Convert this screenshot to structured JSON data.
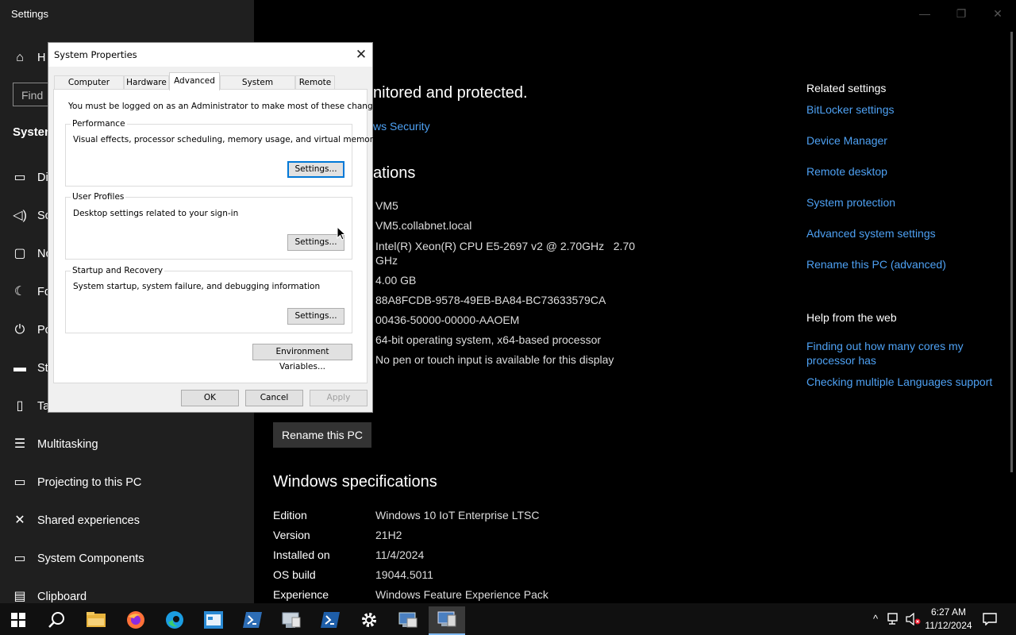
{
  "window": {
    "title": "Settings",
    "minimize": "—",
    "restore": "❐",
    "close": "✕"
  },
  "sidebar": {
    "home_label": "H",
    "find_placeholder": "Find",
    "system_label": "System",
    "items": [
      {
        "label": "Di",
        "icon": "display-icon",
        "glyph": "▭"
      },
      {
        "label": "Sc",
        "icon": "sound-icon",
        "glyph": "🔈"
      },
      {
        "label": "No",
        "icon": "notifications-icon",
        "glyph": "▢"
      },
      {
        "label": "Fo",
        "icon": "focus-assist-icon",
        "glyph": "☾"
      },
      {
        "label": "Po",
        "icon": "power-icon",
        "glyph": "⏻"
      },
      {
        "label": "St",
        "icon": "storage-icon",
        "glyph": "▬"
      },
      {
        "label": "Ta",
        "icon": "tablet-icon",
        "glyph": "▯"
      },
      {
        "label": "Multitasking",
        "icon": "multitasking-icon",
        "glyph": "☰"
      },
      {
        "label": "Projecting to this PC",
        "icon": "projecting-icon",
        "glyph": "▭"
      },
      {
        "label": "Shared experiences",
        "icon": "shared-experiences-icon",
        "glyph": "✕"
      },
      {
        "label": "System Components",
        "icon": "system-components-icon",
        "glyph": "▭"
      },
      {
        "label": "Clipboard",
        "icon": "clipboard-icon",
        "glyph": "▤"
      }
    ]
  },
  "main": {
    "protected_heading": "nitored and protected.",
    "security_link": "ws Security",
    "specs_heading": "ations",
    "device_values": [
      "VM5",
      "VM5.collabnet.local",
      "Intel(R) Xeon(R) CPU E5-2697 v2 @ 2.70GHz   2.70",
      "GHz",
      "4.00 GB",
      "88A8FCDB-9578-49EB-BA84-BC73633579CA",
      "00436-50000-00000-AAOEM",
      "64-bit operating system, x64-based processor",
      "No pen or touch input is available for this display"
    ],
    "rename_button": "Rename this PC",
    "windows_specs_heading": "Windows specifications",
    "windows_specs": [
      {
        "label": "Edition",
        "value": "Windows 10 IoT Enterprise LTSC"
      },
      {
        "label": "Version",
        "value": "21H2"
      },
      {
        "label": "Installed on",
        "value": "11/4/2024"
      },
      {
        "label": "OS build",
        "value": "19044.5011"
      },
      {
        "label": "Experience",
        "value": "Windows Feature Experience Pack"
      }
    ]
  },
  "related": {
    "heading": "Related settings",
    "links": [
      "BitLocker settings",
      "Device Manager",
      "Remote desktop",
      "System protection",
      "Advanced system settings",
      "Rename this PC (advanced)"
    ],
    "help_heading": "Help from the web",
    "help_links": [
      "Finding out how many cores my",
      "processor has",
      "Checking multiple Languages support"
    ]
  },
  "dialog": {
    "title": "System Properties",
    "close": "✕",
    "tabs": [
      "Computer Name",
      "Hardware",
      "Advanced",
      "System Protection",
      "Remote"
    ],
    "admin_note": "You must be logged on as an Administrator to make most of these changes.",
    "performance": {
      "title": "Performance",
      "description": "Visual effects, processor scheduling, memory usage, and virtual memory",
      "button": "Settings..."
    },
    "user_profiles": {
      "title": "User Profiles",
      "description": "Desktop settings related to your sign-in",
      "button": "Settings..."
    },
    "startup": {
      "title": "Startup and Recovery",
      "description": "System startup, system failure, and debugging information",
      "button": "Settings..."
    },
    "env_button": "Environment Variables...",
    "ok": "OK",
    "cancel": "Cancel",
    "apply": "Apply"
  },
  "taskbar": {
    "icons": [
      "start-icon",
      "search-icon",
      "file-explorer-icon",
      "firefox-icon",
      "edge-icon",
      "app-icon",
      "powershell-icon",
      "server-icon",
      "powershell-icon",
      "settings-icon",
      "remote-desktop-icon",
      "system-properties-icon"
    ],
    "time": "6:27 AM",
    "date": "11/12/2024"
  }
}
